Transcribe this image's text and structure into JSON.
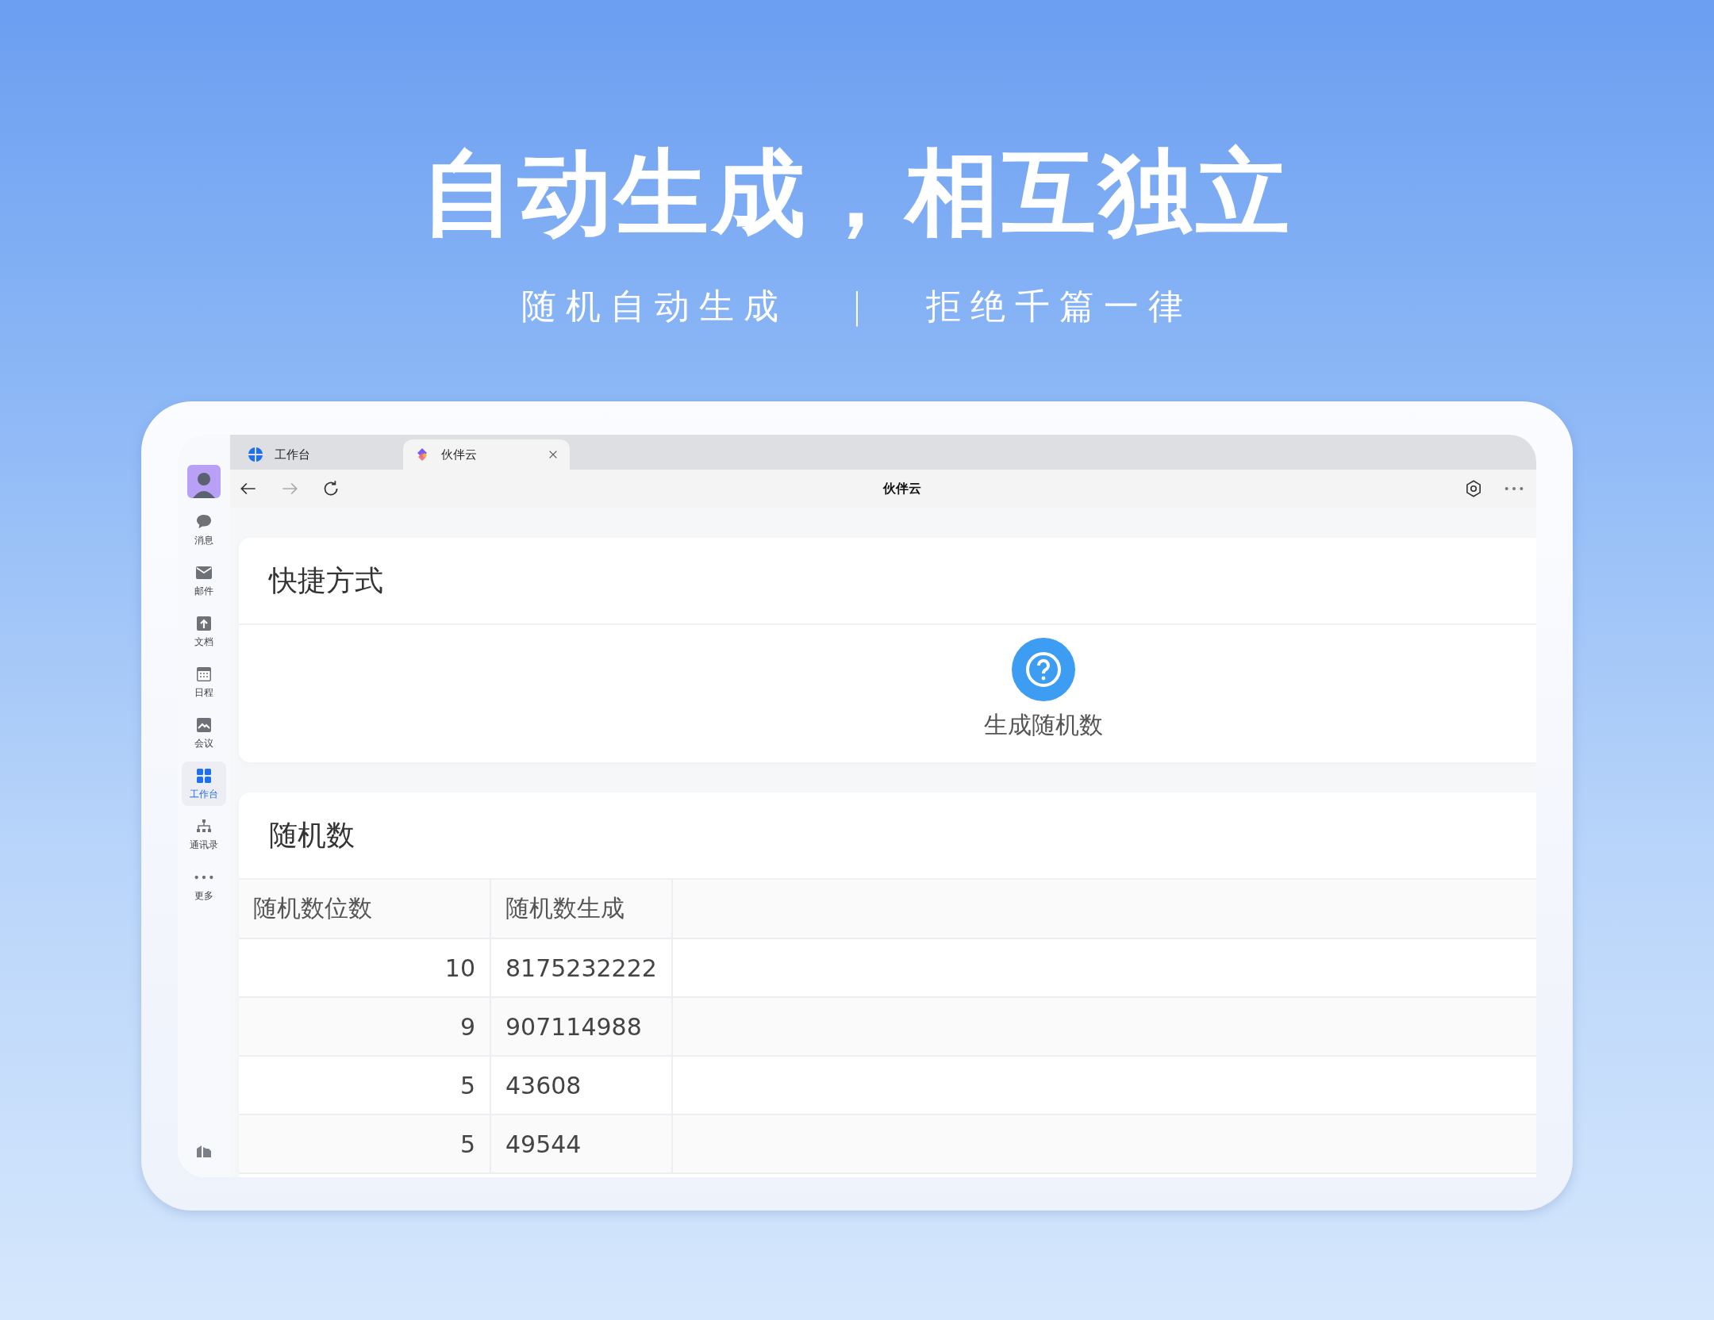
{
  "headline": "自动生成，相互独立",
  "subtitle": {
    "left": "随机自动生成",
    "separator": "|",
    "right": "拒绝千篇一律"
  },
  "sidebar": {
    "items": [
      {
        "kind": "chat",
        "label": "消息",
        "selected": false
      },
      {
        "kind": "mail",
        "label": "邮件",
        "selected": false
      },
      {
        "kind": "doc",
        "label": "文档",
        "selected": false
      },
      {
        "kind": "calendar",
        "label": "日程",
        "selected": false
      },
      {
        "kind": "meeting",
        "label": "会议",
        "selected": false
      },
      {
        "kind": "grid",
        "label": "工作台",
        "selected": true
      },
      {
        "kind": "org",
        "label": "通讯录",
        "selected": false
      },
      {
        "kind": "more",
        "label": "更多",
        "selected": false
      }
    ]
  },
  "tabs": [
    {
      "kind": "workbench",
      "label": "工作台",
      "selected": false
    },
    {
      "kind": "app",
      "label": "伙伴云",
      "selected": true
    }
  ],
  "page_title": "伙伴云",
  "shortcuts": {
    "title": "快捷方式",
    "items": [
      {
        "label": "生成随机数"
      }
    ]
  },
  "random": {
    "title": "随机数",
    "table": {
      "columns": [
        "随机数位数",
        "随机数生成"
      ],
      "rows": [
        [
          "10",
          "8175232222"
        ],
        [
          "9",
          "907114988"
        ],
        [
          "5",
          "43608"
        ],
        [
          "5",
          "49544"
        ]
      ]
    }
  }
}
